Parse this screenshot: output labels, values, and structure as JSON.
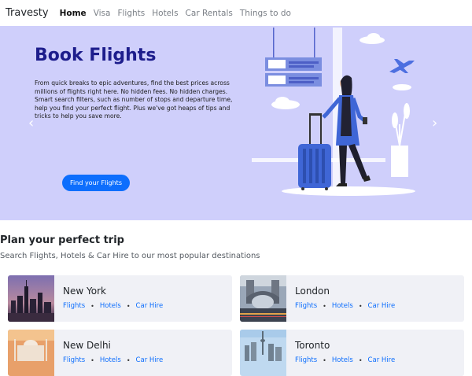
{
  "navbar": {
    "brand": "Travesty",
    "items": [
      {
        "label": "Home",
        "active": true
      },
      {
        "label": "Visa"
      },
      {
        "label": "Flights"
      },
      {
        "label": "Hotels"
      },
      {
        "label": "Car Rentals"
      },
      {
        "label": "Things to do"
      }
    ]
  },
  "hero": {
    "title": "Book Flights",
    "text": "From quick breaks to epic adventures, find the best prices across millions of flights right here. No hidden fees. No hidden charges. Smart search filters, such as number of stops and departure time, help you find your perfect flight. Plus we've got heaps of tips and tricks to help you save more.",
    "button": "Find your Flights",
    "prev_icon": "chevron-left-icon",
    "next_icon": "chevron-right-icon",
    "prev_glyph": "‹",
    "next_glyph": "›"
  },
  "section": {
    "title": "Plan your perfect trip",
    "subtitle": "Search Flights, Hotels & Car Hire to our most popular destinations"
  },
  "destinations": [
    {
      "city": "New York",
      "links": [
        "Flights",
        "Hotels",
        "Car Hire"
      ]
    },
    {
      "city": "London",
      "links": [
        "Flights",
        "Hotels",
        "Car Hire"
      ]
    },
    {
      "city": "New Delhi",
      "links": [
        "Flights",
        "Hotels",
        "Car Hire"
      ]
    },
    {
      "city": "Toronto",
      "links": [
        "Flights",
        "Hotels",
        "Car Hire"
      ]
    }
  ],
  "colors": {
    "hero_bg": "#cfcffb",
    "title": "#1d1d8c",
    "primary": "#0d6efd",
    "card_bg": "#f0f1f6"
  }
}
